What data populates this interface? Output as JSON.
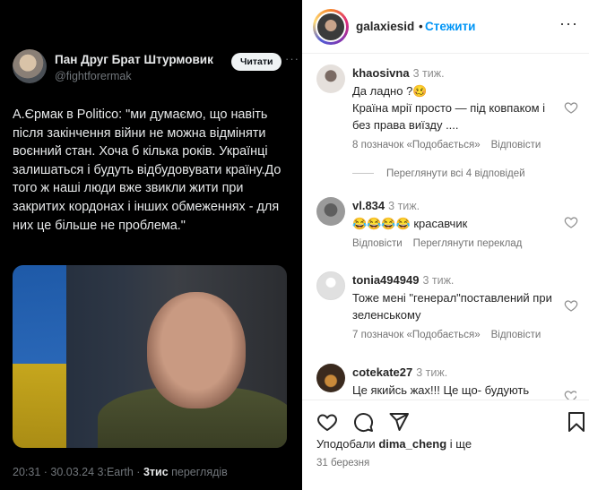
{
  "tweet": {
    "name": "Пан Друг Брат Штурмовик",
    "handle": "@fightforermak",
    "follow_label": "Читати",
    "more": "···",
    "text": "А.Єрмак в Politico: \"ми думаємо, що навіть після закінчення війни не можна відміняти воєнний стан. Хоча б кілька років. Українці залишаться і будуть відбудовувати країну.До того ж наші люди вже звикли жити при закритих кордонах і інших обмеженнях - для них це більше не проблема.\"",
    "meta_time": "20:31 · 30.03.24 3:Earth · ",
    "meta_views_count": "3тис",
    "meta_views_label": " переглядів"
  },
  "post": {
    "username": "galaxiesid",
    "dot": "•",
    "follow_label": "Стежити",
    "more": "···"
  },
  "comments": [
    {
      "user": "khaosivna",
      "time": "3 тиж.",
      "text": "Да ладно ?🥴\nКраїна мрії просто — під ковпаком і без права виїзду ....",
      "likes": "8 позначок «Подобається»",
      "reply": "Відповісти"
    },
    {
      "user": "vl.834",
      "time": "3 тиж.",
      "text": "😂😂😂😂  красавчик",
      "reply": "Відповісти",
      "translate": "Переглянути переклад"
    },
    {
      "user": "tonia494949",
      "time": "3 тиж.",
      "text": "Тоже мені \"генерал\"поставлений при зеленському",
      "likes": "7 позначок «Подобається»",
      "reply": "Відповісти"
    },
    {
      "user": "cotekate27",
      "time": "3 тиж.",
      "text": "Це якийсь жах!!! Це що- будують"
    }
  ],
  "replies_link": "Переглянути всі 4 відповідей",
  "footer": {
    "liked_by_prefix": "Уподобали ",
    "liked_by_user": "dima_cheng",
    "liked_by_suffix": " і ще",
    "date": "31 березня"
  }
}
